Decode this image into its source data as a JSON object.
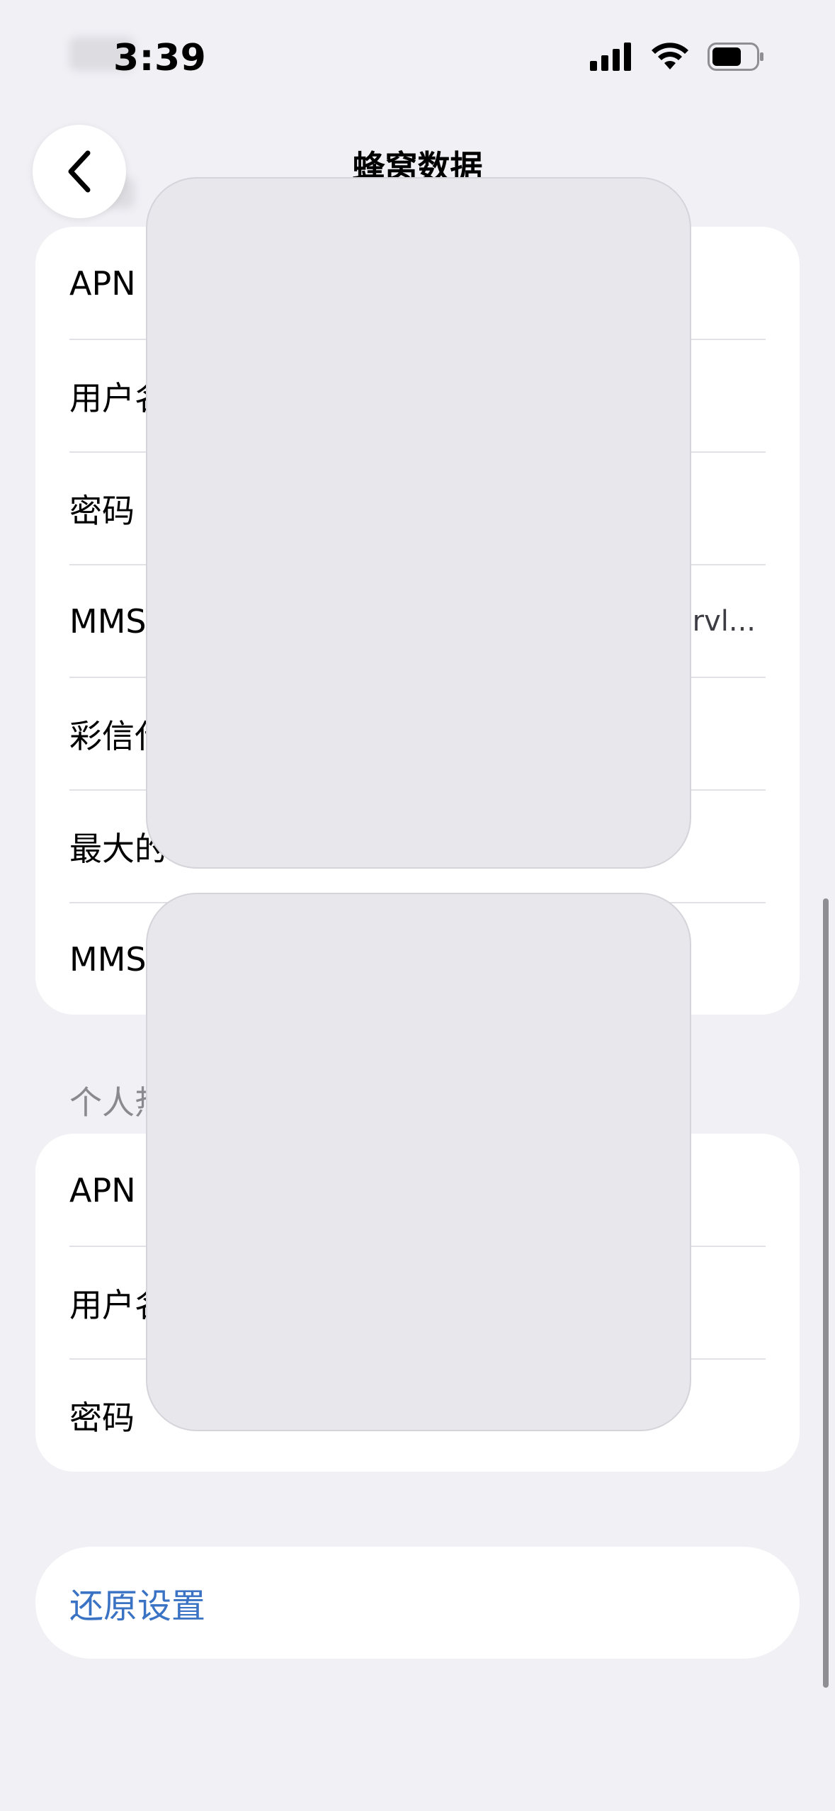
{
  "status_bar": {
    "time": "3:39",
    "icons": [
      "signal-bars-icon",
      "wifi-icon",
      "battery-icon"
    ]
  },
  "nav": {
    "back_icon": "chevron-left-icon",
    "title": "蜂窝数据"
  },
  "mms_card": {
    "rows": [
      {
        "label": "APN",
        "value": ""
      },
      {
        "label": "用户名",
        "value": ""
      },
      {
        "label": "密码",
        "value": ""
      },
      {
        "label": "MMSC",
        "value": "ervl..."
      },
      {
        "label": "彩信代理",
        "value": ""
      },
      {
        "label": "最大的彩信大小",
        "value": ""
      },
      {
        "label": "MMS UA Prof URL",
        "value": ""
      }
    ]
  },
  "hotspot_section": {
    "header": "个人热点"
  },
  "hotspot_card": {
    "rows": [
      {
        "label": "APN",
        "value": ""
      },
      {
        "label": "用户名",
        "value": ""
      },
      {
        "label": "密码",
        "value": ""
      }
    ]
  },
  "reset": {
    "label": "还原设置"
  },
  "colors": {
    "background": "#f0f0f5",
    "card": "#ffffff",
    "link": "#3a72c4",
    "secondary_text": "#8a8a8e"
  }
}
